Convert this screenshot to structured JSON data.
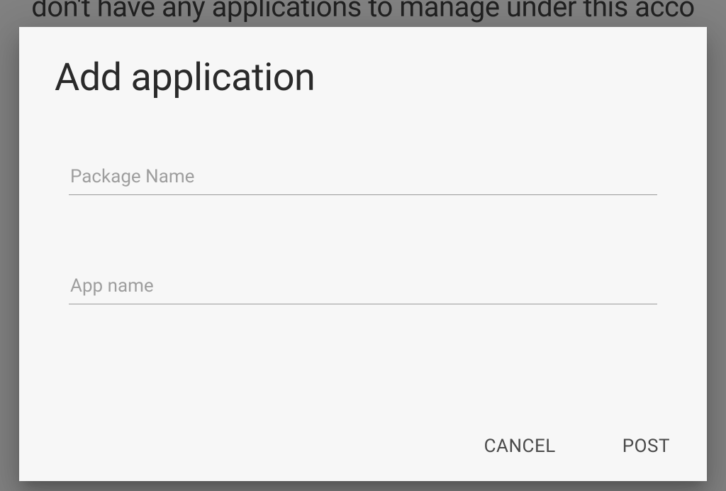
{
  "background": {
    "text": "don't have any applications to manage under this acco"
  },
  "dialog": {
    "title": "Add application",
    "fields": {
      "package_name": {
        "placeholder": "Package Name",
        "value": ""
      },
      "app_name": {
        "placeholder": "App name",
        "value": ""
      }
    },
    "actions": {
      "cancel": "CANCEL",
      "post": "POST"
    }
  }
}
